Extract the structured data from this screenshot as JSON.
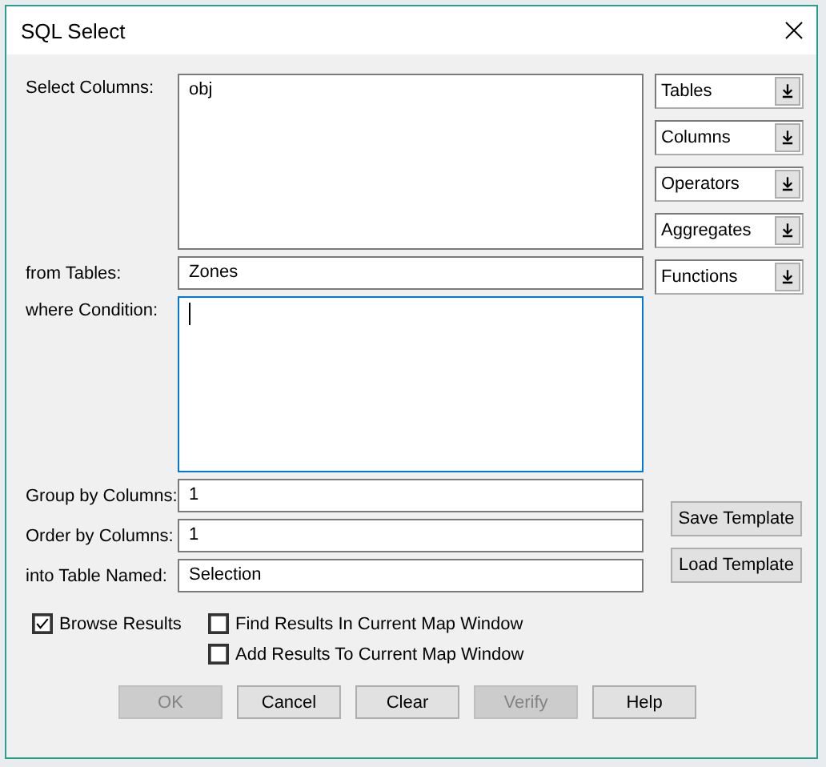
{
  "window": {
    "title": "SQL Select"
  },
  "fields": [
    {
      "label": "Select Columns:",
      "kind": "area",
      "value": "obj",
      "focused": false
    },
    {
      "label": "from Tables:",
      "kind": "line",
      "value": "Zones",
      "focused": false
    },
    {
      "label": "where Condition:",
      "kind": "area",
      "focused": true
    },
    {
      "label": "Group by Columns:",
      "kind": "line",
      "value": "1",
      "focused": false
    },
    {
      "label": "Order by Columns:",
      "kind": "line",
      "value": "1",
      "focused": false
    },
    {
      "label": "into Table Named:",
      "kind": "line",
      "value": "Selection",
      "focused": false
    }
  ],
  "pickers": [
    "Tables",
    "Columns",
    "Operators",
    "Aggregates",
    "Functions"
  ],
  "template_buttons": [
    "Save Template",
    "Load Template"
  ],
  "options": [
    {
      "label": "Browse Results",
      "checked": true
    },
    {
      "label": "Find Results In Current Map Window",
      "checked": false
    },
    {
      "label": "Add Results To Current Map Window",
      "checked": false
    }
  ],
  "buttons": [
    {
      "label": "OK",
      "disabled": true
    },
    {
      "label": "Cancel",
      "disabled": false
    },
    {
      "label": "Clear",
      "disabled": false
    },
    {
      "label": "Verify",
      "disabled": true
    },
    {
      "label": "Help",
      "disabled": false
    }
  ]
}
